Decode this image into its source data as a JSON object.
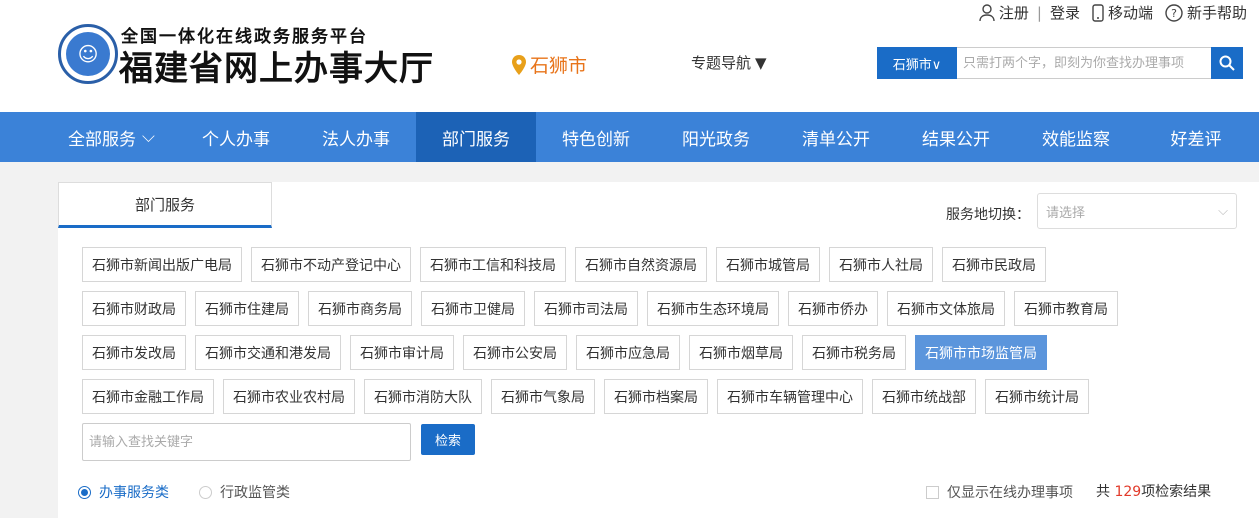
{
  "header": {
    "logo_sub": "全国一体化在线政务服务平台",
    "logo_main": "福建省网上办事大厅",
    "city": "石狮市",
    "topic_nav": "专题导航",
    "top_links": {
      "register": "注册",
      "login": "登录",
      "mobile": "移动端",
      "help": "新手帮助"
    },
    "search": {
      "scope": "石狮市∨",
      "placeholder": "只需打两个字，即刻为你查找办理事项"
    }
  },
  "nav": {
    "items": [
      {
        "label": "全部服务"
      },
      {
        "label": "个人办事"
      },
      {
        "label": "法人办事"
      },
      {
        "label": "部门服务"
      },
      {
        "label": "特色创新"
      },
      {
        "label": "阳光政务"
      },
      {
        "label": "清单公开"
      },
      {
        "label": "结果公开"
      },
      {
        "label": "效能监察"
      },
      {
        "label": "好差评"
      }
    ],
    "active_index": 3
  },
  "panel": {
    "tab_label": "部门服务",
    "location_label": "服务地切换：",
    "location_placeholder": "请选择",
    "departments": [
      [
        "石狮市新闻出版广电局",
        "石狮市不动产登记中心",
        "石狮市工信和科技局",
        "石狮市自然资源局",
        "石狮市城管局",
        "石狮市人社局",
        "石狮市民政局"
      ],
      [
        "石狮市财政局",
        "石狮市住建局",
        "石狮市商务局",
        "石狮市卫健局",
        "石狮市司法局",
        "石狮市生态环境局",
        "石狮市侨办",
        "石狮市文体旅局",
        "石狮市教育局"
      ],
      [
        "石狮市发改局",
        "石狮市交通和港发局",
        "石狮市审计局",
        "石狮市公安局",
        "石狮市应急局",
        "石狮市烟草局",
        "石狮市税务局",
        "石狮市市场监管局"
      ],
      [
        "石狮市金融工作局",
        "石狮市农业农村局",
        "石狮市消防大队",
        "石狮市气象局",
        "石狮市档案局",
        "石狮市车辆管理中心",
        "石狮市统战部",
        "石狮市统计局"
      ]
    ],
    "active_department": "石狮市市场监管局",
    "keyword_placeholder": "请输入查找关键字",
    "search_button": "检索",
    "radio_options": [
      "办事服务类",
      "行政监管类"
    ],
    "radio_selected": 0,
    "online_only_label": "仅显示在线办理事项",
    "result_prefix": "共",
    "result_count": "129",
    "result_suffix": "项检索结果"
  },
  "colors": {
    "primary": "#1a6cc7",
    "nav_bg": "#3b82d8",
    "nav_active": "#1c62b6",
    "dept_active": "#5b95dc",
    "city": "#e8741a",
    "count": "#e23a2a"
  }
}
